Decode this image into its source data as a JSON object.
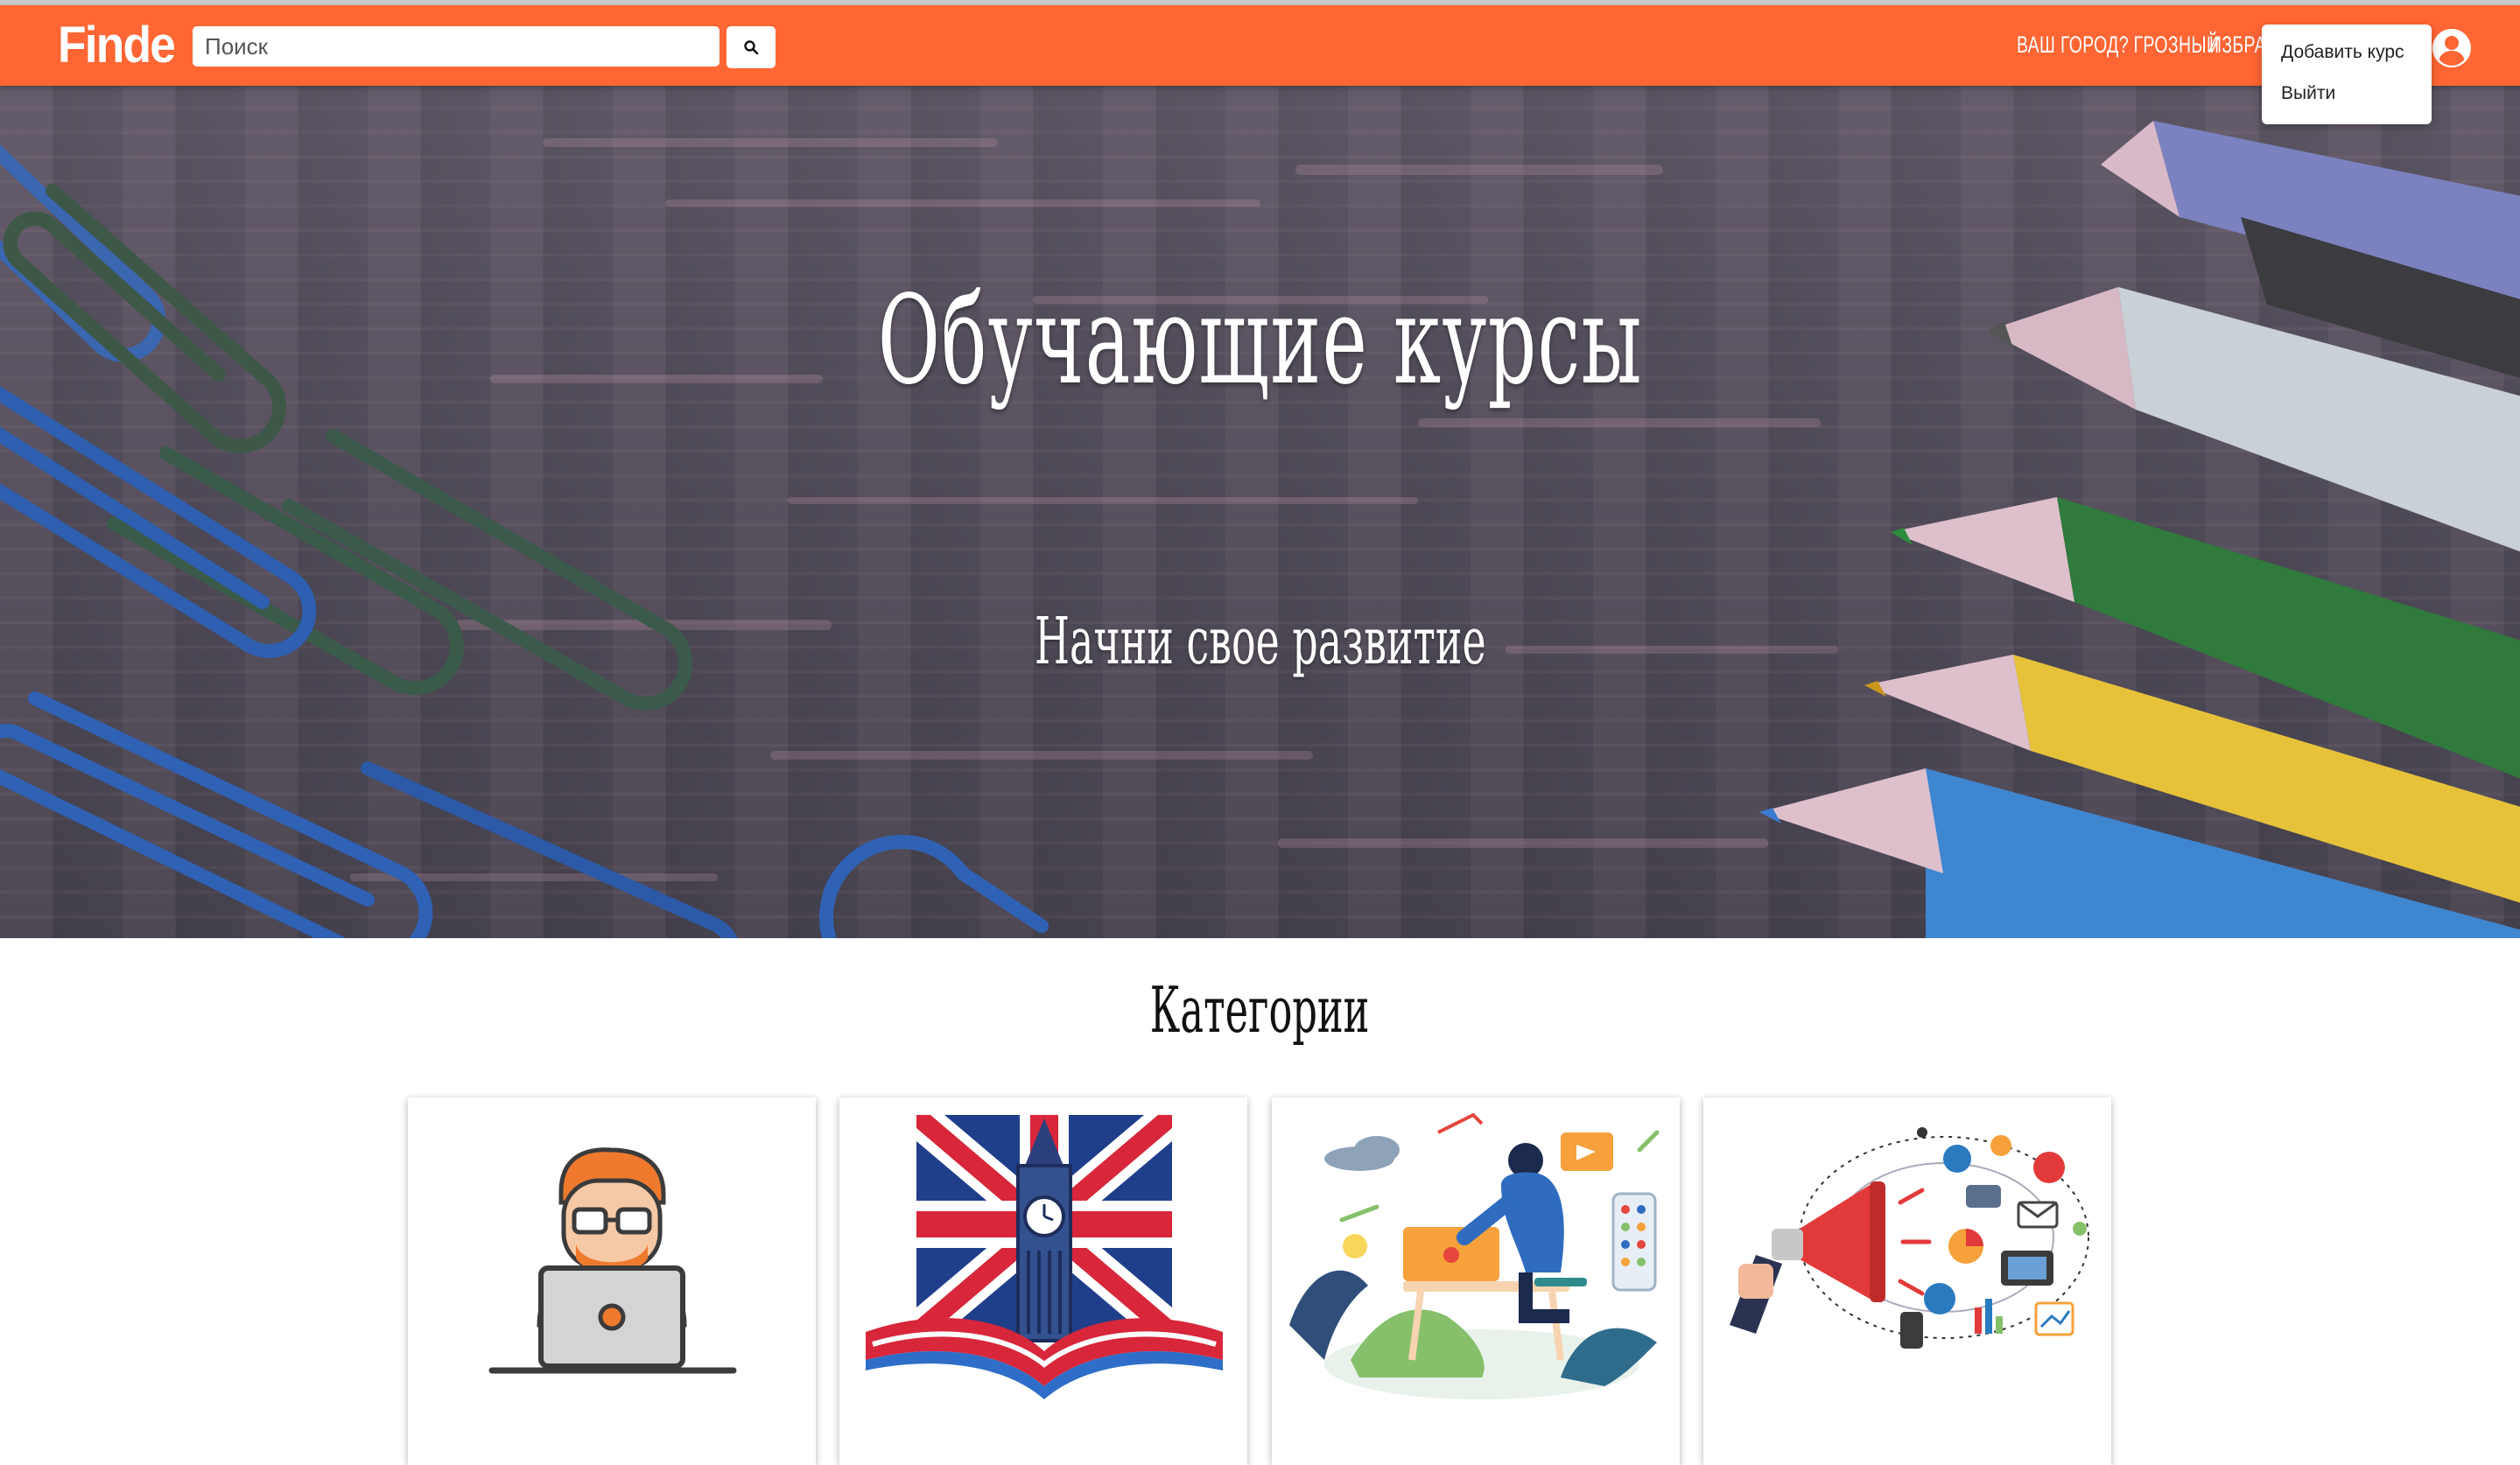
{
  "navbar": {
    "logo": "Finde",
    "search_placeholder": "Поиск",
    "search_icon": "search-icon",
    "city_link": "Ваш город? Грозный",
    "favorites_link": "Избранное",
    "user_icon": "user-circle-icon",
    "background": "#ff6633"
  },
  "dropdown": {
    "items": [
      {
        "label": "Добавить курс"
      },
      {
        "label": "Выйти"
      }
    ]
  },
  "hero": {
    "title": "Обучающие курсы",
    "subtitle": "Начни свое развитие"
  },
  "categories": {
    "title": "Категории",
    "cards": [
      {
        "icon": "programmer-laptop-icon",
        "label": ""
      },
      {
        "icon": "british-flag-big-ben-icon",
        "label": ""
      },
      {
        "icon": "designer-workspace-icon",
        "label": ""
      },
      {
        "icon": "marketing-megaphone-icon",
        "label": ""
      }
    ]
  }
}
